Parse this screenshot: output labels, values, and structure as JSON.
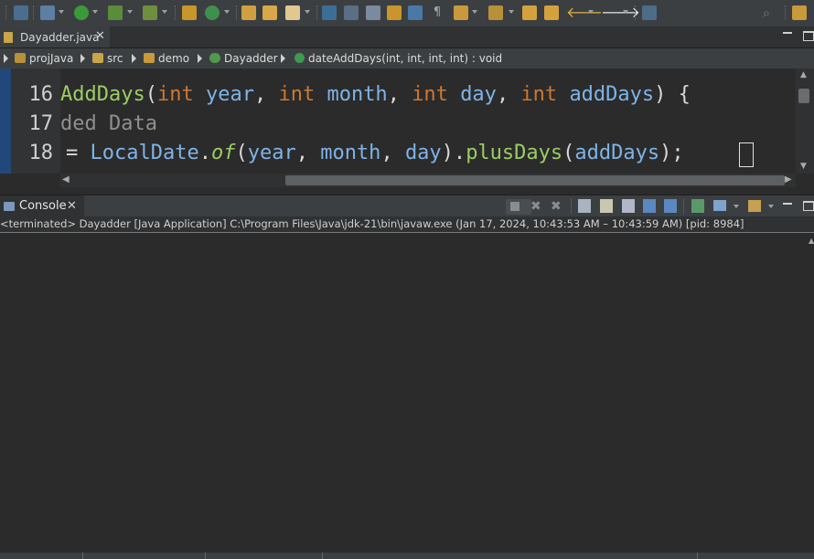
{
  "editor_tab": {
    "label": "Dayadder.java"
  },
  "breadcrumb": {
    "items": [
      "projJava",
      "src",
      "demo",
      "Dayadder",
      "dateAddDays(int, int, int, int) : void"
    ]
  },
  "editor": {
    "line_numbers": [
      "16",
      "17",
      "18"
    ],
    "line16": {
      "method": "AddDays",
      "open": "(",
      "kw1": "int",
      "p1": "year",
      "kw2": "int",
      "p2": "month",
      "kw3": "int",
      "p3": "day",
      "kw4": "int",
      "p4": "addDays",
      "close": ") {"
    },
    "line17": {
      "comment": "ded Data"
    },
    "line18": {
      "eq": "= ",
      "cls": "LocalDate",
      "dot1": ".",
      "of": "of",
      "open": "(",
      "a1": "year",
      "a2": "month",
      "a3": "day",
      "close1": ").",
      "plus": "plusDays",
      "open2": "(",
      "a4": "addDays",
      "close2": ");"
    }
  },
  "console": {
    "tab_label": "Console",
    "status": "<terminated> Dayadder [Java Application] C:\\Program Files\\Java\\jdk-21\\bin\\javaw.exe  (Jan 17, 2024, 10:43:53 AM – 10:43:59 AM) [pid: 8984]"
  },
  "colors": {
    "keyword": "#cc7832",
    "identifier": "#7fb3e6",
    "method": "#9ccc65",
    "comment": "#8f8f8f",
    "gutter_accent": "#21487b"
  }
}
